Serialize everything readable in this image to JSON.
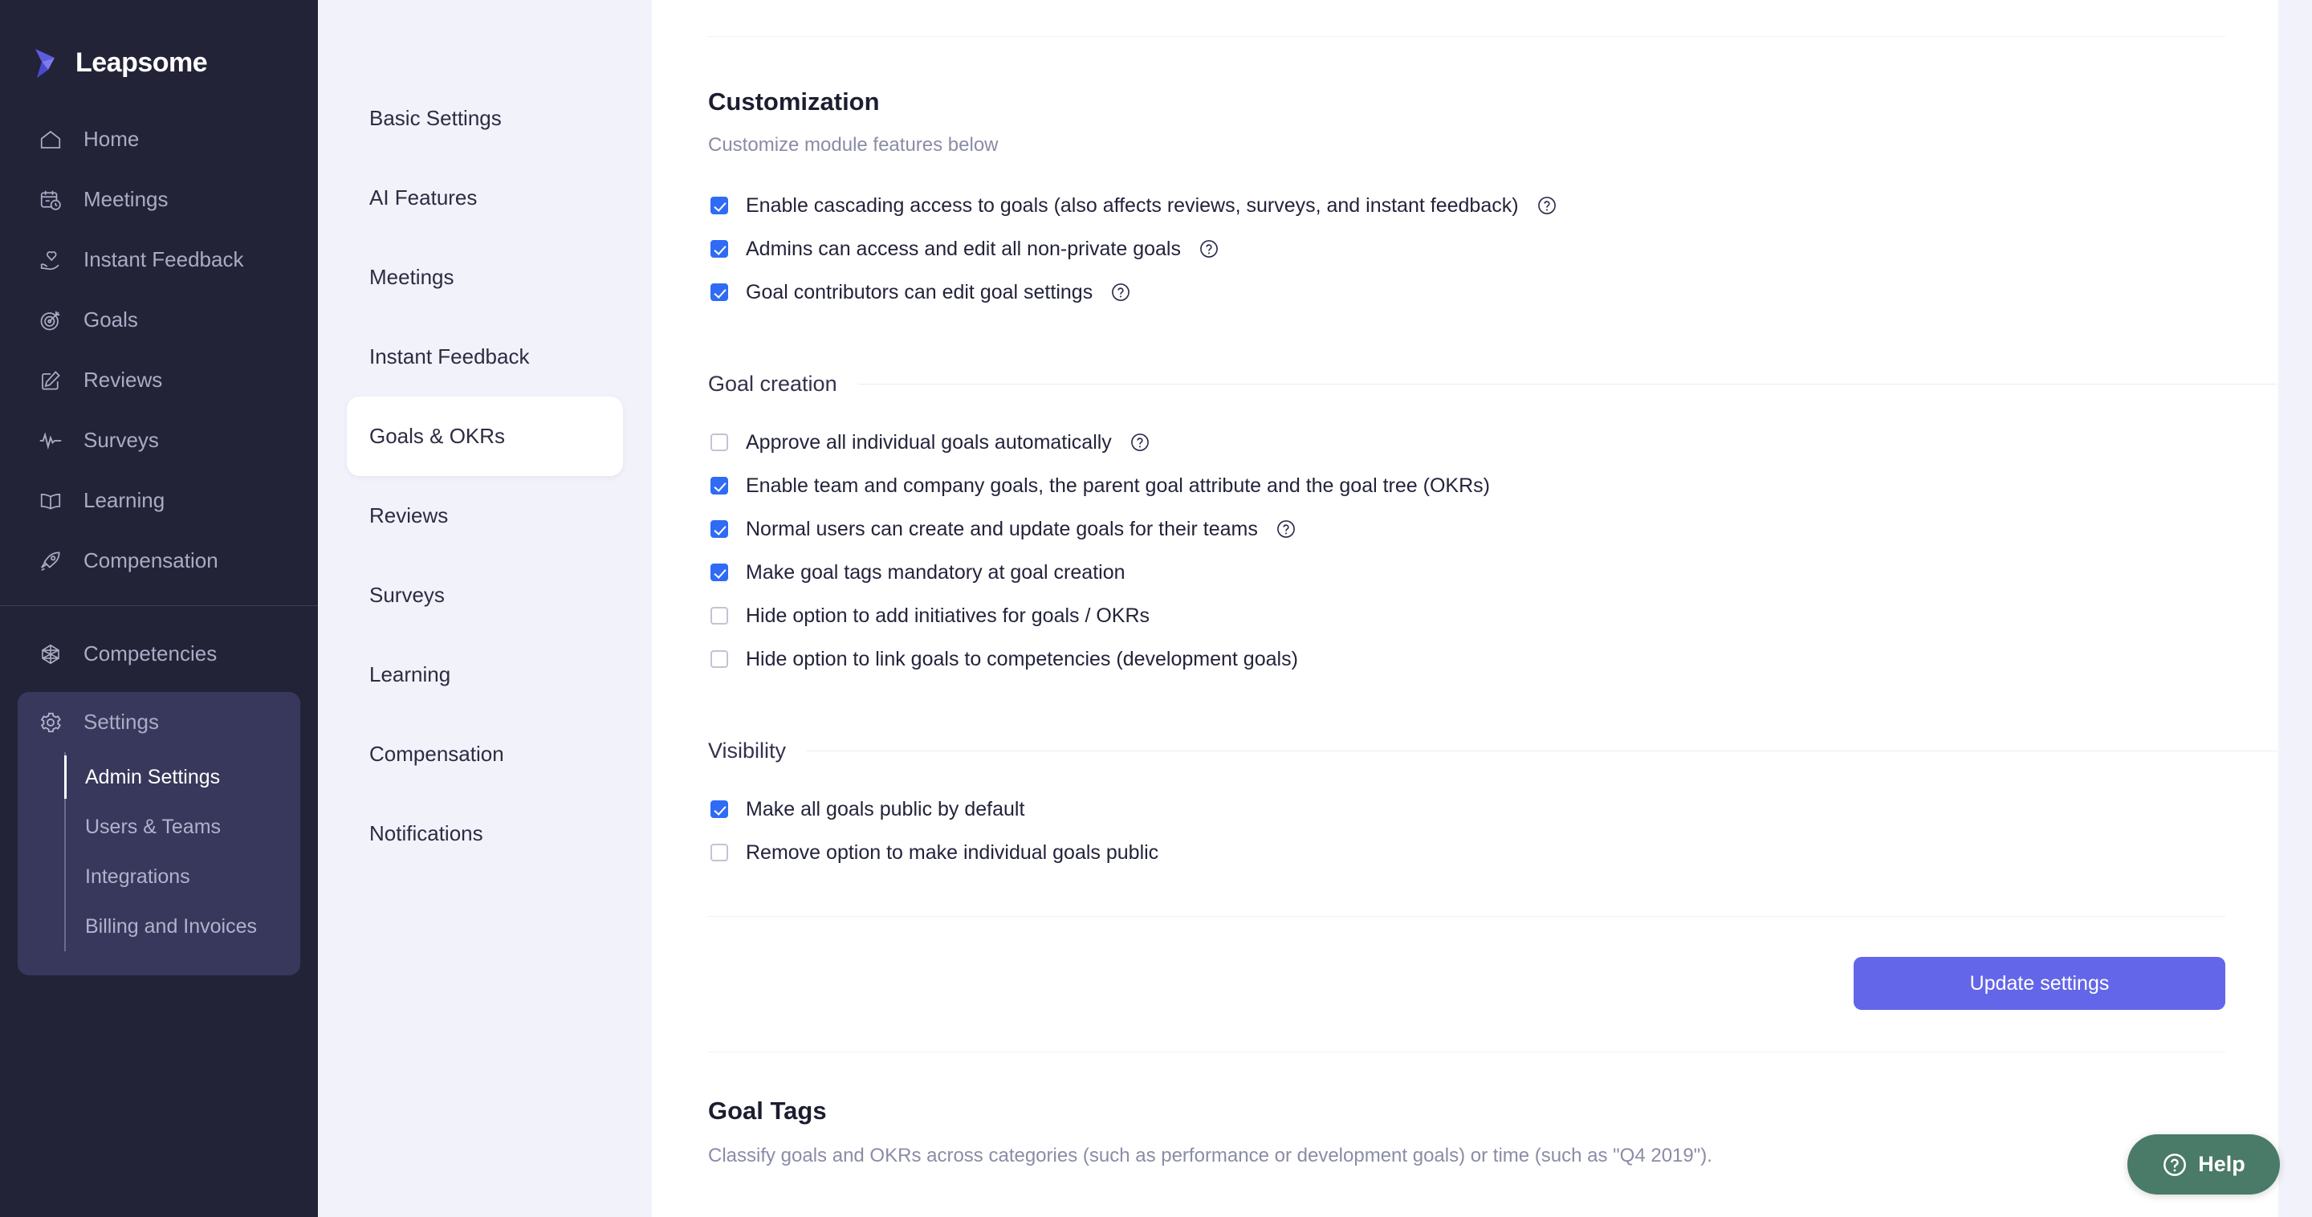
{
  "brand": {
    "name": "Leapsome",
    "logo_icon": "leapsome-bird-logo"
  },
  "sidebar": {
    "primary_items": [
      {
        "label": "Home",
        "icon": "home-icon"
      },
      {
        "label": "Meetings",
        "icon": "calendar-clock-icon"
      },
      {
        "label": "Instant Feedback",
        "icon": "hand-heart-icon"
      },
      {
        "label": "Goals",
        "icon": "target-icon"
      },
      {
        "label": "Reviews",
        "icon": "edit-square-icon"
      },
      {
        "label": "Surveys",
        "icon": "pulse-icon"
      },
      {
        "label": "Learning",
        "icon": "open-book-icon"
      },
      {
        "label": "Compensation",
        "icon": "rocket-icon"
      }
    ],
    "lower_items": [
      {
        "label": "Competencies",
        "icon": "polyhedron-icon"
      }
    ],
    "settings": {
      "label": "Settings",
      "icon": "gear-icon",
      "sub_items": [
        {
          "label": "Admin Settings",
          "active": true
        },
        {
          "label": "Users & Teams",
          "active": false
        },
        {
          "label": "Integrations",
          "active": false
        },
        {
          "label": "Billing and Invoices",
          "active": false
        }
      ]
    }
  },
  "subnav": {
    "items": [
      {
        "label": "Basic Settings",
        "active": false
      },
      {
        "label": "AI Features",
        "active": false
      },
      {
        "label": "Meetings",
        "active": false
      },
      {
        "label": "Instant Feedback",
        "active": false
      },
      {
        "label": "Goals & OKRs",
        "active": true
      },
      {
        "label": "Reviews",
        "active": false
      },
      {
        "label": "Surveys",
        "active": false
      },
      {
        "label": "Learning",
        "active": false
      },
      {
        "label": "Compensation",
        "active": false
      },
      {
        "label": "Notifications",
        "active": false
      }
    ]
  },
  "main": {
    "customization": {
      "title": "Customization",
      "subtitle": "Customize module features below",
      "options": [
        {
          "label": "Enable cascading access to goals (also affects reviews, surveys, and instant feedback)",
          "checked": true,
          "has_help": true
        },
        {
          "label": "Admins can access and edit all non-private goals",
          "checked": true,
          "has_help": true
        },
        {
          "label": "Goal contributors can edit goal settings",
          "checked": true,
          "has_help": true
        }
      ]
    },
    "goal_creation": {
      "title": "Goal creation",
      "options": [
        {
          "label": "Approve all individual goals automatically",
          "checked": false,
          "has_help": true
        },
        {
          "label": "Enable team and company goals, the parent goal attribute and the goal tree (OKRs)",
          "checked": true,
          "has_help": false
        },
        {
          "label": "Normal users can create and update goals for their teams",
          "checked": true,
          "has_help": true
        },
        {
          "label": "Make goal tags mandatory at goal creation",
          "checked": true,
          "has_help": false
        },
        {
          "label": "Hide option to add initiatives for goals / OKRs",
          "checked": false,
          "has_help": false
        },
        {
          "label": "Hide option to link goals to competencies (development goals)",
          "checked": false,
          "has_help": false
        }
      ]
    },
    "visibility": {
      "title": "Visibility",
      "options": [
        {
          "label": "Make all goals public by default",
          "checked": true,
          "has_help": false
        },
        {
          "label": "Remove option to make individual goals public",
          "checked": false,
          "has_help": false
        }
      ]
    },
    "update_button": "Update settings",
    "goal_tags": {
      "title": "Goal Tags",
      "subtitle": "Classify goals and OKRs across categories (such as performance or development goals) or time (such as \"Q4 2019\")."
    }
  },
  "help_widget": {
    "label": "Help",
    "icon": "question-circle-icon"
  },
  "colors": {
    "sidebar_bg": "#232338",
    "settings_highlight": "#38385c",
    "subnav_bg": "#f2f2fb",
    "accent_button": "#6366e8",
    "checkbox_checked": "#2f6bf5",
    "help_green": "#4a7a68",
    "brand_purple": "#5c5ce0"
  }
}
